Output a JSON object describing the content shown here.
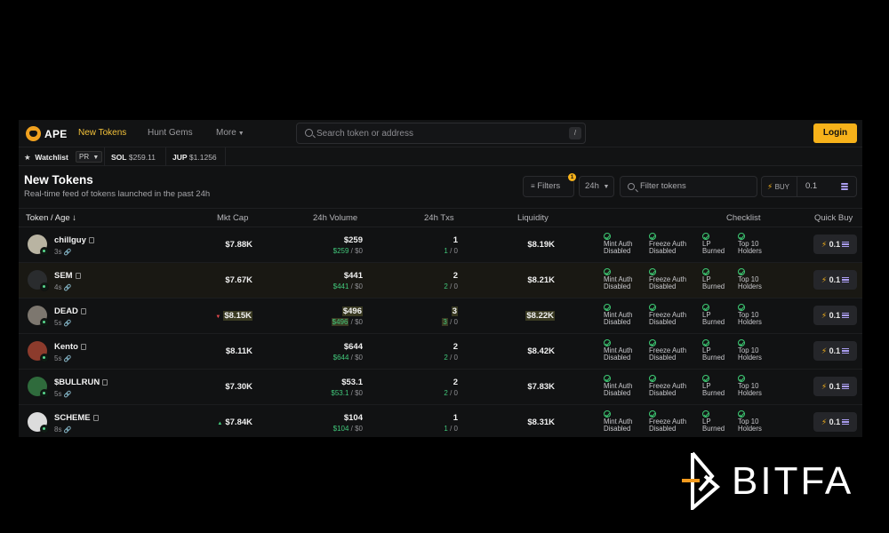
{
  "nav": {
    "logo_text": "APE",
    "items": [
      "New Tokens",
      "Hunt Gems",
      "More"
    ],
    "search_placeholder": "Search token or address",
    "search_shortcut": "/",
    "login_label": "Login"
  },
  "ticker": {
    "watchlist_label": "Watchlist",
    "watchlist_tag": "PR",
    "sol_label": "SOL",
    "sol_value": "$259.11",
    "jup_label": "JUP",
    "jup_value": "$1.1256"
  },
  "header": {
    "title": "New Tokens",
    "subtitle": "Real-time feed of tokens launched in the past 24h",
    "filters_label": "Filters",
    "filters_badge": "1",
    "timeframe": "24h",
    "filter_tokens_placeholder": "Filter tokens",
    "buy_label": "BUY",
    "buy_amount": "0.1"
  },
  "table": {
    "columns": [
      "Token / Age",
      "Mkt Cap",
      "24h Volume",
      "24h Txs",
      "Liquidity",
      "Checklist",
      "Quick Buy"
    ],
    "checklist_labels": [
      "Mint Auth Disabled",
      "Freeze Auth Disabled",
      "LP Burned",
      "Top 10 Holders"
    ],
    "quick_buy_amount": "0.1",
    "rows": [
      {
        "name": "chillguy",
        "age": "3s",
        "mcap": "$7.88K",
        "volume": "$259",
        "vol_buy": "$259",
        "vol_sell": "$0",
        "txs": "1",
        "txs_buy": "1",
        "txs_sell": "0",
        "liquidity": "$8.19K",
        "trend": "",
        "highlight": false
      },
      {
        "name": "SEM",
        "age": "4s",
        "mcap": "$7.67K",
        "volume": "$441",
        "vol_buy": "$441",
        "vol_sell": "$0",
        "txs": "2",
        "txs_buy": "2",
        "txs_sell": "0",
        "liquidity": "$8.21K",
        "trend": "",
        "highlight": false
      },
      {
        "name": "DEAD",
        "age": "5s",
        "mcap": "$8.15K",
        "volume": "$496",
        "vol_buy": "$496",
        "vol_sell": "$0",
        "txs": "3",
        "txs_buy": "3",
        "txs_sell": "0",
        "liquidity": "$8.22K",
        "trend": "down",
        "highlight": true
      },
      {
        "name": "Kento",
        "age": "5s",
        "mcap": "$8.11K",
        "volume": "$644",
        "vol_buy": "$644",
        "vol_sell": "$0",
        "txs": "2",
        "txs_buy": "2",
        "txs_sell": "0",
        "liquidity": "$8.42K",
        "trend": "",
        "highlight": false
      },
      {
        "name": "$BULLRUN",
        "age": "5s",
        "mcap": "$7.30K",
        "volume": "$53.1",
        "vol_buy": "$53.1",
        "vol_sell": "$0",
        "txs": "2",
        "txs_buy": "2",
        "txs_sell": "0",
        "liquidity": "$7.83K",
        "trend": "",
        "highlight": false
      },
      {
        "name": "SCHEME",
        "age": "8s",
        "mcap": "$7.84K",
        "volume": "$104",
        "vol_buy": "$104",
        "vol_sell": "$0",
        "txs": "1",
        "txs_buy": "1",
        "txs_sell": "0",
        "liquidity": "$8.31K",
        "trend": "up",
        "highlight": false
      }
    ]
  },
  "watermark": {
    "text": "BITFA"
  },
  "colors": {
    "accent": "#f7b21a",
    "green": "#41c77a",
    "red": "#e5484d",
    "background": "#000000",
    "panel": "#111213"
  }
}
